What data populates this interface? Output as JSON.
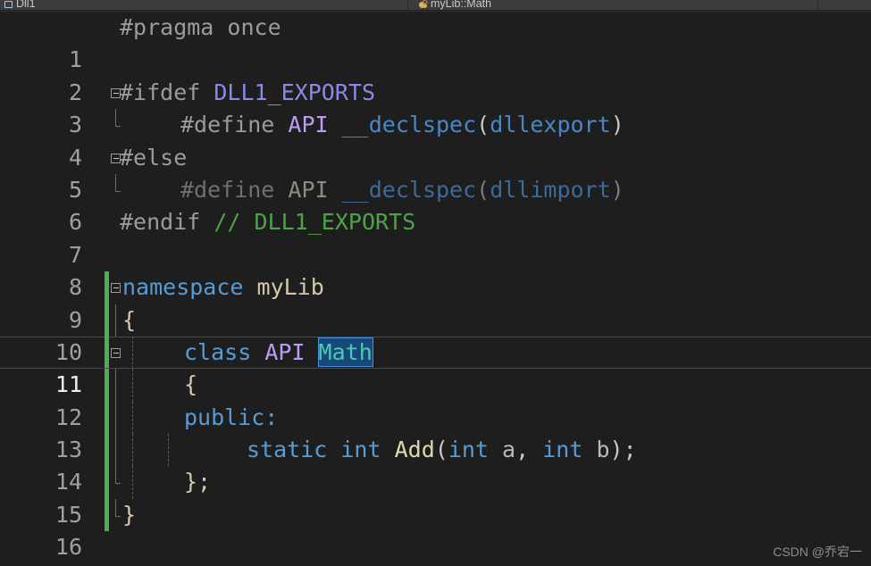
{
  "nav_bar": {
    "left_segment": {
      "icon": "project-icon",
      "label": "Dll1"
    },
    "middle_segment": {
      "icon": "class-icon",
      "label": "myLib::Math"
    }
  },
  "editor": {
    "active_line_number": 11,
    "change_bar_color": "#4caf50",
    "selection": {
      "text": "Math",
      "background": "#16487a",
      "border": "#4a90d9"
    },
    "lines": [
      {
        "num": "1",
        "text": "#pragma once"
      },
      {
        "num": "2",
        "text": ""
      },
      {
        "num": "3",
        "text": "#ifdef DLL1_EXPORTS"
      },
      {
        "num": "4",
        "text": "    #define API __declspec(dllexport)"
      },
      {
        "num": "5",
        "text": "#else"
      },
      {
        "num": "6",
        "text": "    #define API __declspec(dllimport)"
      },
      {
        "num": "7",
        "text": "#endif // DLL1_EXPORTS"
      },
      {
        "num": "8",
        "text": ""
      },
      {
        "num": "9",
        "text": "namespace myLib"
      },
      {
        "num": "10",
        "text": "{"
      },
      {
        "num": "11",
        "text": "    class API Math"
      },
      {
        "num": "12",
        "text": "    {"
      },
      {
        "num": "13",
        "text": "    public:"
      },
      {
        "num": "14",
        "text": "        static int Add(int a, int b);"
      },
      {
        "num": "15",
        "text": "    };"
      },
      {
        "num": "16",
        "text": "}"
      }
    ],
    "tokens": {
      "pragma_once_directive": "#pragma once",
      "ifdef_directive": "#ifdef",
      "dll1_exports_macro": "DLL1_EXPORTS",
      "define_directive": "#define",
      "api_macro": "API",
      "declspec_keyword": "__declspec",
      "dllexport_arg": "dllexport",
      "dllimport_arg": "dllimport",
      "else_directive": "#else",
      "endif_directive": "#endif",
      "endif_comment": "// DLL1_EXPORTS",
      "namespace_keyword": "namespace",
      "namespace_name": "myLib",
      "open_brace": "{",
      "close_brace": "}",
      "class_keyword": "class",
      "class_name": "Math",
      "public_label": "public:",
      "static_keyword": "static",
      "int_keyword": "int",
      "function_name": "Add",
      "param_a": "a",
      "param_b": "b",
      "open_paren": "(",
      "close_paren": ")",
      "comma": ",",
      "semicolon": ";",
      "close_brace_semicolon": "};"
    }
  },
  "watermark": {
    "text": "CSDN @乔宕一"
  }
}
